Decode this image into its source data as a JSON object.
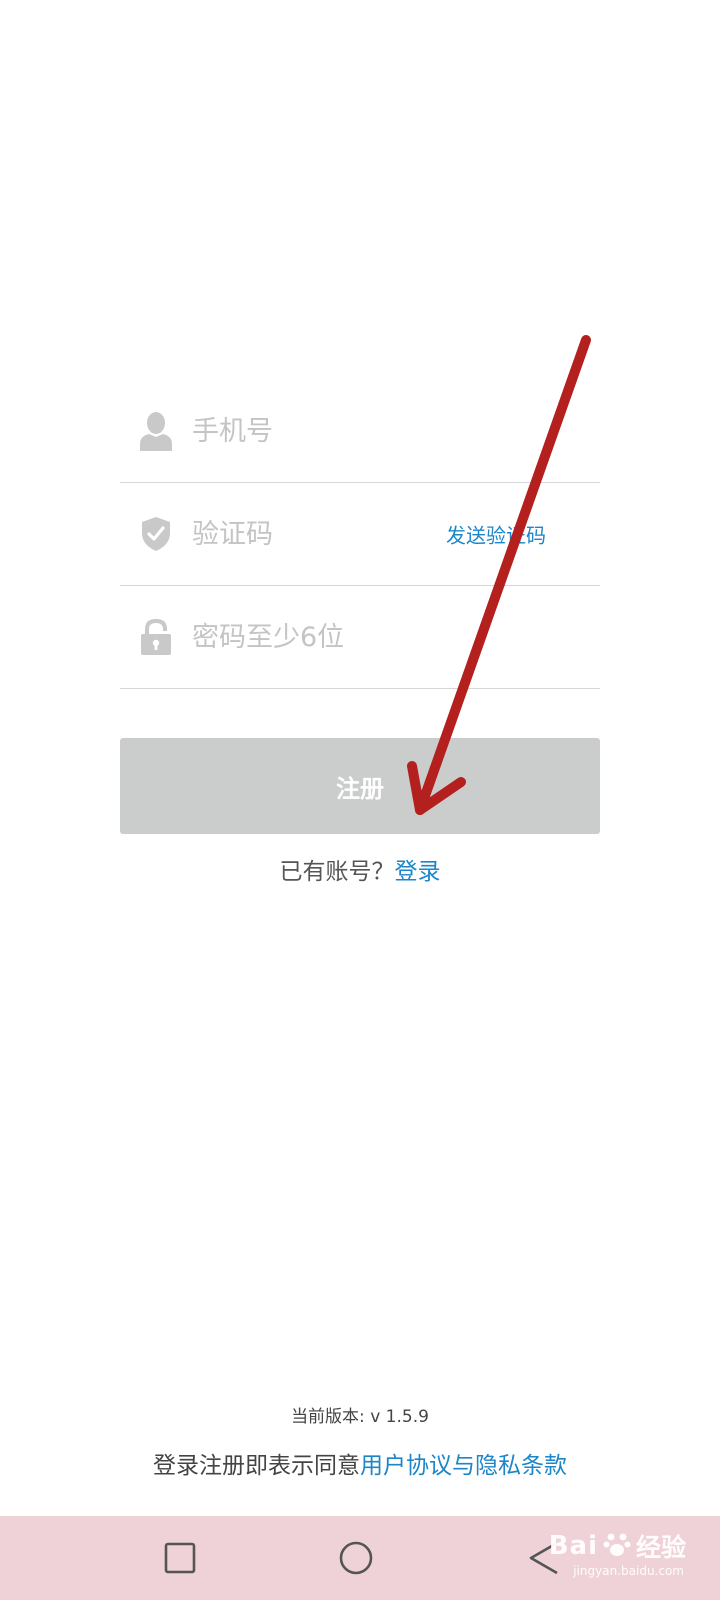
{
  "form": {
    "phone_placeholder": "手机号",
    "code_placeholder": "验证码",
    "send_code_label": "发送验证码",
    "password_placeholder": "密码至少6位",
    "phone_icon": "user-icon",
    "code_icon": "shield-check-icon",
    "password_icon": "lock-icon"
  },
  "register": {
    "button_label": "注册"
  },
  "login": {
    "prompt": "已有账号？",
    "link_label": "登录"
  },
  "footer": {
    "version": "当前版本: v 1.5.9",
    "agreement_prefix": "登录注册即表示同意",
    "agreement_link": "用户协议与隐私条款"
  },
  "navbar": {
    "recent_icon": "square-icon",
    "home_icon": "circle-icon",
    "back_icon": "triangle-back-icon"
  },
  "watermark": {
    "brand": "Bai",
    "brand_suffix": "经验",
    "url": "jingyan.baidu.com"
  },
  "colors": {
    "accent": "#1c86c8",
    "button_disabled": "#cbcccc",
    "navbar_bg": "#efd2d8",
    "annotation_arrow": "#b3201d"
  }
}
